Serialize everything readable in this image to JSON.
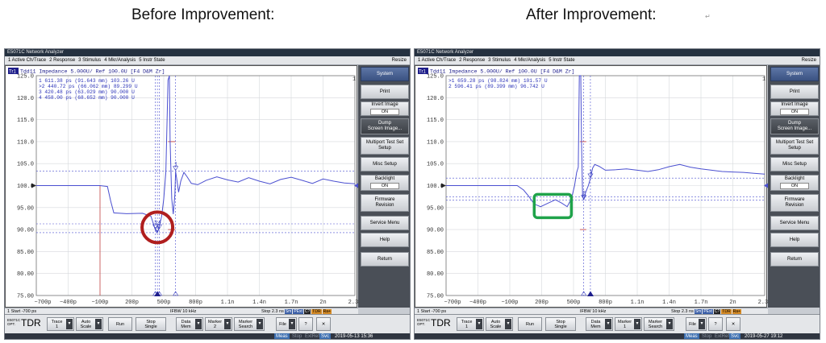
{
  "headings": {
    "before": "Before Improvement:",
    "after": "After Improvement:"
  },
  "screens": [
    {
      "app_title": "E5071C Network Analyzer",
      "menu": [
        "1 Active Ch/Trace",
        "2 Response",
        "3 Stimulus",
        "4 Mkr/Analysis",
        "5 Instr State"
      ],
      "resize": "Resize",
      "trace_badge": "Tr1",
      "trace_label": "Tdd11 Impedance 5.000U/ Ref 100.0U [F4 D&M Zr]",
      "channel_num": "1",
      "markers": [
        "  1   611.38 ps (91.643 mm)  103.26 U",
        ">2   440.72 ps (66.062 mm)  89.299 U",
        "  3   420.48 ps (63.029 mm)  90.000 U",
        "  4   458.00 ps (68.652 mm)  90.000 U"
      ],
      "y_ticks": [
        "125.0",
        "120.0",
        "115.0",
        "110.0",
        "105.0",
        "100.0",
        "95.00",
        "90.00",
        "85.00",
        "80.00",
        "75.00"
      ],
      "x_ticks": [
        "−700p",
        "−400p",
        "−100p",
        "200p",
        "500p",
        "800p",
        "1.1n",
        "1.4n",
        "1.7n",
        "2n",
        "2.3n"
      ],
      "softkeys": [
        {
          "label": "System",
          "style": "title"
        },
        {
          "label": "Print"
        },
        {
          "label": "Invert Image",
          "sub": "ON"
        },
        {
          "label": "Dump\nScreen Image...",
          "style": "dark"
        },
        {
          "label": "Multiport Test Set\nSetup"
        },
        {
          "label": "Misc Setup"
        },
        {
          "label": "Backlight",
          "sub": "ON"
        },
        {
          "label": "Firmware\nRevision"
        },
        {
          "label": "Service Menu"
        },
        {
          "label": "Help"
        },
        {
          "label": "Return"
        }
      ],
      "status": {
        "start": "1  Start -700 ps",
        "ifbw": "IFBW 10 kHz",
        "stop": "Stop 2.3 ns",
        "tags": [
          "Sm",
          "PExt",
          "C?",
          "TDR",
          "Ra+"
        ]
      },
      "toolbar": {
        "logo_line1": "E5071C",
        "logo_line2": "OPT.",
        "logo_main": "TDR",
        "buttons": [
          "Trace\n1",
          "Auto\nScale",
          "Run",
          "Stop\nSingle",
          "Data\nMem",
          "Marker\n2",
          "Marker\nSearch",
          "File",
          "?",
          "✕"
        ]
      },
      "bottom": {
        "meas": "Meas",
        "stop": "Stop",
        "extref": "ExtRef",
        "svc": "Svc",
        "datetime": "2019-05-13 15:36"
      }
    },
    {
      "app_title": "E5071C Network Analyzer",
      "menu": [
        "1 Active Ch/Trace",
        "2 Response",
        "3 Stimulus",
        "4 Mkr/Analysis",
        "5 Instr State"
      ],
      "resize": "Resize",
      "trace_badge": "Tr1",
      "trace_label": "Tdd11 Impedance 5.000U/ Ref 100.0U [F4 D&M Zr]",
      "channel_num": "1",
      "markers": [
        ">1   659.28 ps (98.824 mm)  101.57 U",
        "  2   596.41 ps (89.399 mm)  96.742 U"
      ],
      "y_ticks": [
        "125.0",
        "120.0",
        "115.0",
        "110.0",
        "105.0",
        "100.0",
        "95.00",
        "90.00",
        "85.00",
        "80.00",
        "75.00"
      ],
      "x_ticks": [
        "−700p",
        "−400p",
        "−100p",
        "200p",
        "500p",
        "800p",
        "1.1n",
        "1.4n",
        "1.7n",
        "2n",
        "2.3n"
      ],
      "softkeys": [
        {
          "label": "System",
          "style": "title"
        },
        {
          "label": "Print"
        },
        {
          "label": "Invert Image",
          "sub": "ON"
        },
        {
          "label": "Dump\nScreen Image...",
          "style": "dark"
        },
        {
          "label": "Multiport Test Set\nSetup"
        },
        {
          "label": "Misc Setup"
        },
        {
          "label": "Backlight",
          "sub": "ON"
        },
        {
          "label": "Firmware\nRevision"
        },
        {
          "label": "Service Menu"
        },
        {
          "label": "Help"
        },
        {
          "label": "Return"
        }
      ],
      "status": {
        "start": "1  Start -700 ps",
        "ifbw": "IFBW 10 kHz",
        "stop": "Stop 2.3 ns",
        "tags": [
          "Sm",
          "PExt",
          "C?",
          "TDR",
          "Ra+"
        ]
      },
      "toolbar": {
        "logo_line1": "E5071C",
        "logo_line2": "OPT.",
        "logo_main": "TDR",
        "buttons": [
          "Trace\n1",
          "Auto\nScale",
          "Run",
          "Stop\nSingle",
          "Data\nMem",
          "Marker\n1",
          "Marker\nSearch",
          "File",
          "?",
          "✕"
        ]
      },
      "bottom": {
        "meas": "Meas",
        "stop": "Stop",
        "extref": "ExtRef",
        "svc": "Svc",
        "datetime": "2019-05-27 19:12"
      }
    }
  ],
  "highlight_colors": {
    "before": "#b01e1e",
    "after": "#1fa34a"
  },
  "trace_color": "#4a4fd0"
}
